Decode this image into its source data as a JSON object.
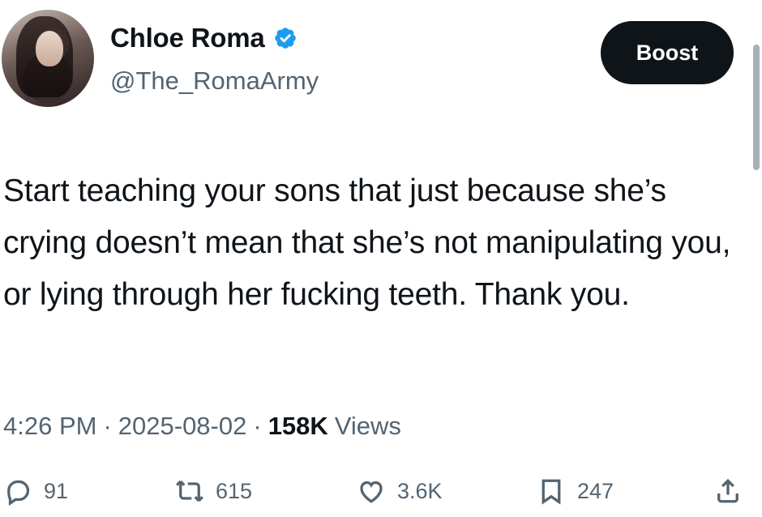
{
  "author": {
    "name": "Chloe Roma",
    "handle": "@The_RomaArmy"
  },
  "boost_label": "Boost",
  "tweet_text": "Start teaching your sons that just because she’s crying doesn’t mean that she’s not manipulating you, or lying through her fucking teeth. Thank you.",
  "meta": {
    "time": "4:26 PM",
    "sep1": "·",
    "date": "2025-08-02",
    "sep2": "·",
    "views_count": "158K",
    "views_label": "Views"
  },
  "actions": {
    "replies": "91",
    "reposts": "615",
    "likes": "3.6K",
    "bookmarks": "247"
  },
  "colors": {
    "text": "#0f1419",
    "secondary": "#536471",
    "verified": "#1d9bf0",
    "button_bg": "#0f1419"
  },
  "icons": [
    "verified-badge-icon",
    "reply-icon",
    "repost-icon",
    "like-icon",
    "bookmark-icon",
    "share-icon"
  ]
}
